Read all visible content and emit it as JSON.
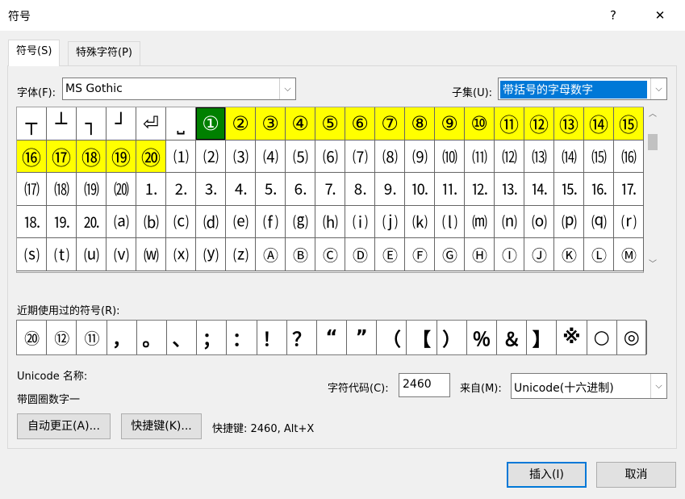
{
  "window": {
    "title": "符号",
    "help": "?",
    "close": "✕"
  },
  "tabs": [
    {
      "label": "符号(S)"
    },
    {
      "label": "特殊字符(P)"
    }
  ],
  "font": {
    "label": "字体(F):",
    "value": "MS Gothic"
  },
  "subset": {
    "label": "子集(U):",
    "value": "带括号的字母数字"
  },
  "symbols": [
    [
      "┬",
      "┴",
      "┐",
      "┘",
      "⏎",
      "⎵",
      "①",
      "②",
      "③",
      "④",
      "⑤",
      "⑥",
      "⑦",
      "⑧",
      "⑨",
      "⑩",
      "⑪",
      "⑫",
      "⑬",
      "⑭",
      "⑮"
    ],
    [
      "⑯",
      "⑰",
      "⑱",
      "⑲",
      "⑳",
      "⑴",
      "⑵",
      "⑶",
      "⑷",
      "⑸",
      "⑹",
      "⑺",
      "⑻",
      "⑼",
      "⑽",
      "⑾",
      "⑿",
      "⒀",
      "⒁",
      "⒂",
      "⒃"
    ],
    [
      "⒄",
      "⒅",
      "⒆",
      "⒇",
      "⒈",
      "⒉",
      "⒊",
      "⒋",
      "⒌",
      "⒍",
      "⒎",
      "⒏",
      "⒐",
      "⒑",
      "⒒",
      "⒓",
      "⒔",
      "⒕",
      "⒖",
      "⒗",
      "⒘"
    ],
    [
      "⒙",
      "⒚",
      "⒛",
      "⒜",
      "⒝",
      "⒞",
      "⒟",
      "⒠",
      "⒡",
      "⒢",
      "⒣",
      "⒤",
      "⒥",
      "⒦",
      "⒧",
      "⒨",
      "⒩",
      "⒪",
      "⒫",
      "⒬",
      "⒭"
    ],
    [
      "⒮",
      "⒯",
      "⒰",
      "⒱",
      "⒲",
      "⒳",
      "⒴",
      "⒵",
      "Ⓐ",
      "Ⓑ",
      "Ⓒ",
      "Ⓓ",
      "Ⓔ",
      "Ⓕ",
      "Ⓖ",
      "Ⓗ",
      "Ⓘ",
      "Ⓙ",
      "Ⓚ",
      "Ⓛ",
      "Ⓜ"
    ]
  ],
  "selected_symbol": "①",
  "recent": {
    "label": "近期使用过的符号(R):",
    "items": [
      "⑳",
      "⑫",
      "⑪",
      "，",
      "。",
      "、",
      "；",
      "：",
      "！",
      "？",
      "“",
      "”",
      "（",
      "【",
      "）",
      "％",
      "＆",
      "】",
      "※",
      "○",
      "◎"
    ]
  },
  "unicode_name": {
    "label": "Unicode 名称:",
    "value": "带圆圈数字一"
  },
  "char_code": {
    "label": "字符代码(C):",
    "value": "2460"
  },
  "from": {
    "label": "来自(M):",
    "value": "Unicode(十六进制)"
  },
  "buttons": {
    "autocorrect": "自动更正(A)...",
    "shortcut_key": "快捷键(K)...",
    "insert": "插入(I)",
    "cancel": "取消"
  },
  "shortcut_text": "快捷键: 2460, Alt+X",
  "colors": {
    "highlight": "#ffff00",
    "selected": "#008000",
    "accent": "#0078d7"
  },
  "icons": {
    "dropdown": "chevron-down-icon",
    "scroll_up": "scroll-up-icon",
    "scroll_down": "scroll-down-icon"
  }
}
